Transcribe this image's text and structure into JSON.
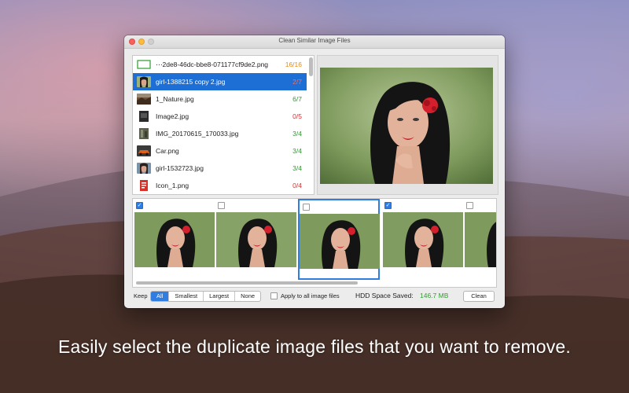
{
  "window": {
    "title": "Clean Similar Image Files"
  },
  "files": [
    {
      "name": "⋯2de8-46dc-bbe8-071177cf9de2.png",
      "count": "16/16",
      "status": "orange",
      "thumb": "frame-icon",
      "selected": false
    },
    {
      "name": "girl-1388215 copy 2.jpg",
      "count": "2/7",
      "status": "red",
      "thumb": "portrait-thumb-icon",
      "selected": true
    },
    {
      "name": "1_Nature.jpg",
      "count": "6/7",
      "status": "green",
      "thumb": "landscape-thumb-icon",
      "selected": false
    },
    {
      "name": "Image2.jpg",
      "count": "0/5",
      "status": "red",
      "thumb": "dark-thumb-icon",
      "selected": false
    },
    {
      "name": "IMG_20170615_170033.jpg",
      "count": "3/4",
      "status": "green",
      "thumb": "street-thumb-icon",
      "selected": false
    },
    {
      "name": "Car.png",
      "count": "3/4",
      "status": "green",
      "thumb": "car-thumb-icon",
      "selected": false
    },
    {
      "name": "girl-1532723.jpg",
      "count": "3/4",
      "status": "green",
      "thumb": "portrait-thumb-icon",
      "selected": false
    },
    {
      "name": "Icon_1.png",
      "count": "0/4",
      "status": "red",
      "thumb": "red-doc-icon",
      "selected": false
    }
  ],
  "thumbnails": [
    {
      "checked": true,
      "active": false
    },
    {
      "checked": false,
      "active": false
    },
    {
      "checked": false,
      "active": true
    },
    {
      "checked": true,
      "active": false
    },
    {
      "checked": false,
      "active": false
    }
  ],
  "bottombar": {
    "keep_label": "Keep",
    "keep_options": [
      "All",
      "Smallest",
      "Largest",
      "None"
    ],
    "keep_selected": "All",
    "apply_all_label": "Apply to all image files",
    "apply_all_checked": false,
    "hdd_label": "HDD Space Saved:",
    "hdd_value": "146.7 MB",
    "clean_label": "Clean"
  },
  "colors": {
    "accent": "#2f7de1",
    "selection": "#1d6fd6",
    "green": "#2a9d2a",
    "red": "#d93030",
    "orange": "#e88a14"
  },
  "caption": "Easily select the duplicate image files that you want to remove."
}
